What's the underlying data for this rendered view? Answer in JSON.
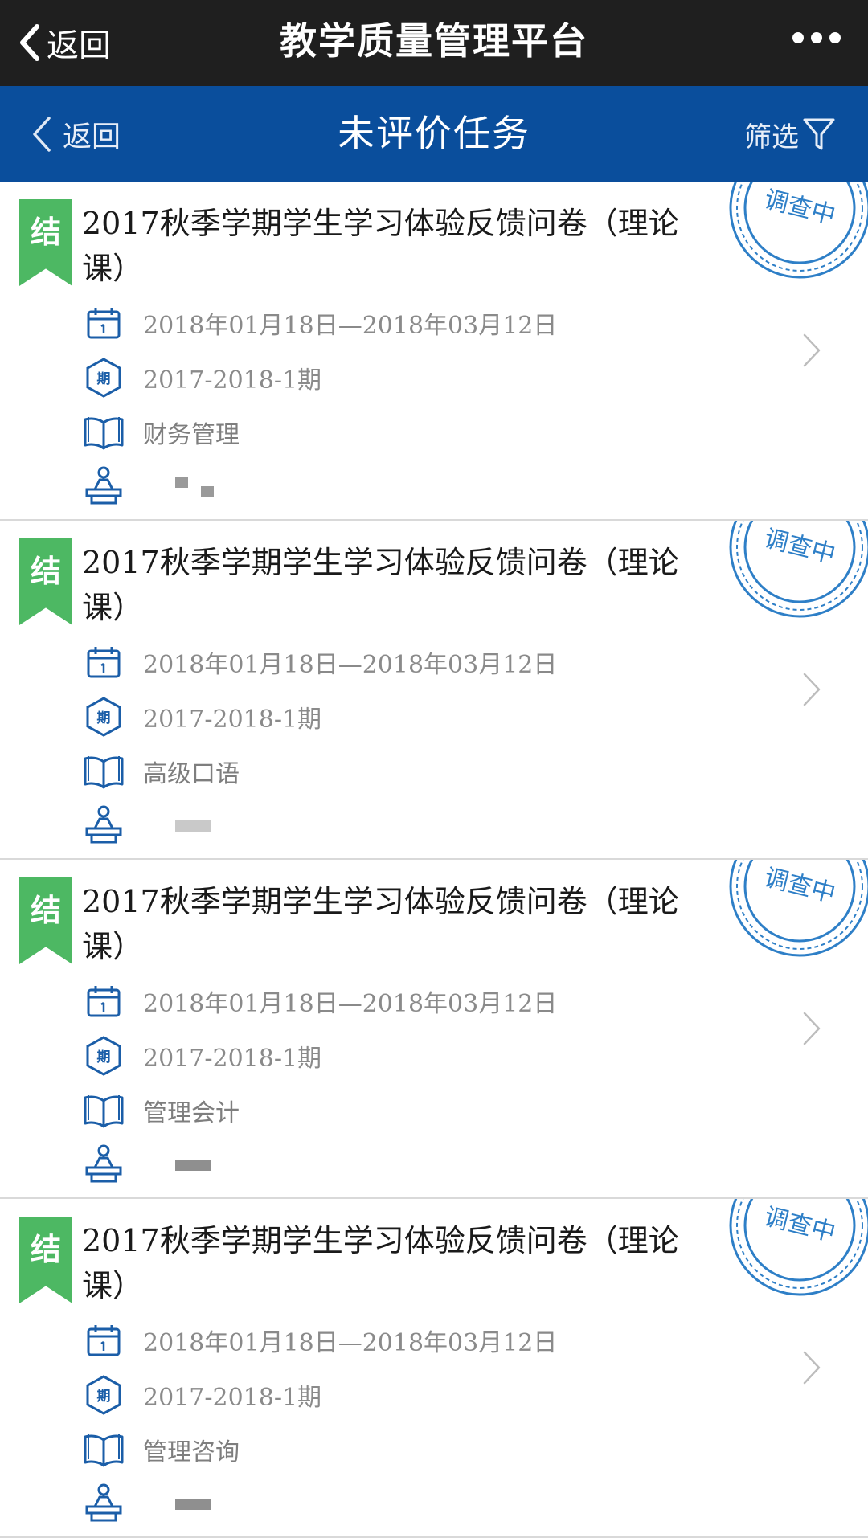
{
  "topbar": {
    "back_label": "返回",
    "title": "教学质量管理平台"
  },
  "header": {
    "back_label": "返回",
    "title": "未评价任务",
    "filter_label": "筛选"
  },
  "colors": {
    "topbar_bg": "#1f1f1f",
    "header_bg": "#0a4e9c",
    "tag_green": "#4db863",
    "icon_blue": "#1b5ea8",
    "stamp_blue": "#2e7fc7"
  },
  "tasks": [
    {
      "tag": "结",
      "title": "2017秋季学期学生学习体验反馈问卷（理论课）",
      "stamp": "调查中",
      "date_range": "2018年01月18日—2018年03月12日",
      "term": "2017-2018-1期",
      "course": "财务管理",
      "term_icon_text": "期"
    },
    {
      "tag": "结",
      "title": "2017秋季学期学生学习体验反馈问卷（理论课）",
      "stamp": "调查中",
      "date_range": "2018年01月18日—2018年03月12日",
      "term": "2017-2018-1期",
      "course": "高级口语",
      "term_icon_text": "期"
    },
    {
      "tag": "结",
      "title": "2017秋季学期学生学习体验反馈问卷（理论课）",
      "stamp": "调查中",
      "date_range": "2018年01月18日—2018年03月12日",
      "term": "2017-2018-1期",
      "course": "管理会计",
      "term_icon_text": "期"
    },
    {
      "tag": "结",
      "title": "2017秋季学期学生学习体验反馈问卷（理论课）",
      "stamp": "调查中",
      "date_range": "2018年01月18日—2018年03月12日",
      "term": "2017-2018-1期",
      "course": "管理咨询",
      "term_icon_text": "期"
    }
  ]
}
